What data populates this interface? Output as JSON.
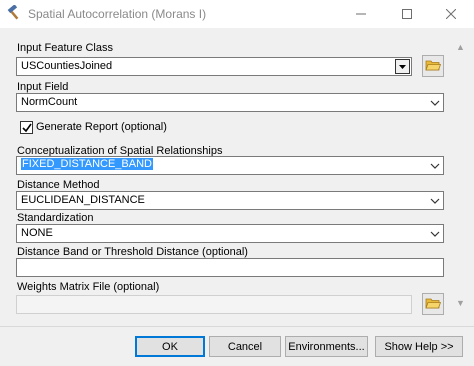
{
  "window": {
    "title": "Spatial Autocorrelation (Morans I)",
    "app_icon": "hammer-icon"
  },
  "form": {
    "input_feature_class": {
      "label": "Input Feature Class",
      "value": "USCountiesJoined",
      "button_icon": "open-folder-icon"
    },
    "input_field": {
      "label": "Input Field",
      "value": "NormCount"
    },
    "generate_report": {
      "label": "Generate Report (optional)",
      "checked": true
    },
    "conceptualization": {
      "label": "Conceptualization of Spatial Relationships",
      "value": "FIXED_DISTANCE_BAND"
    },
    "distance_method": {
      "label": "Distance Method",
      "value": "EUCLIDEAN_DISTANCE"
    },
    "standardization": {
      "label": "Standardization",
      "value": "NONE"
    },
    "distance_band": {
      "label": "Distance Band or Threshold Distance (optional)",
      "value": ""
    },
    "weights_matrix": {
      "label": "Weights Matrix File (optional)",
      "value": "",
      "button_icon": "open-folder-icon"
    }
  },
  "buttons": {
    "ok": "OK",
    "cancel": "Cancel",
    "environments": "Environments...",
    "show_help": "Show Help >>"
  },
  "colors": {
    "selection": "#3399ff",
    "ok_border": "#0078d7",
    "dialog_bg": "#f0f0f0"
  }
}
